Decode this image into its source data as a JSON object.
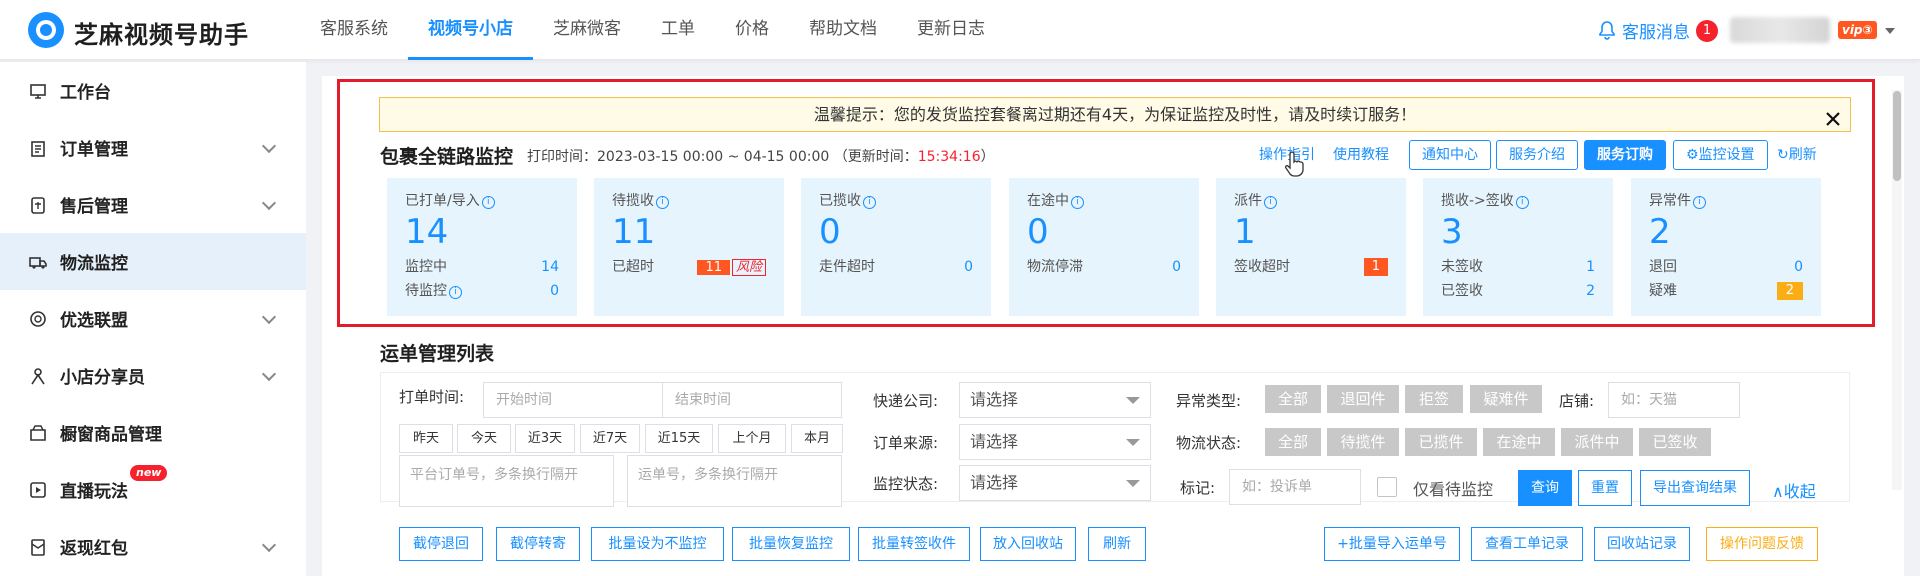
{
  "app": {
    "title": "芝麻视频号助手"
  },
  "nav": [
    "客服系统",
    "视频号小店",
    "芝麻微客",
    "工单",
    "价格",
    "帮助文档",
    "更新日志"
  ],
  "topRight": {
    "msg": "客服消息",
    "msgCount": "1",
    "vip": "vip③"
  },
  "sidebar": [
    {
      "label": "工作台"
    },
    {
      "label": "订单管理"
    },
    {
      "label": "售后管理"
    },
    {
      "label": "物流监控"
    },
    {
      "label": "优选联盟"
    },
    {
      "label": "小店分享员"
    },
    {
      "label": "橱窗商品管理"
    },
    {
      "label": "直播玩法",
      "tag": "new"
    },
    {
      "label": "返现红包"
    }
  ],
  "notice": "温馨提示：您的发货监控套餐离过期还有4天，为保证监控及时性，请及时续订服务！",
  "monitor": {
    "title": "包裹全链路监控",
    "printTimeLabel": "打印时间：2023-03-15 00:00 ~ 04-15 00:00 （更新时间：",
    "updateTime": "15:34:16",
    "closeParen": "）",
    "links": {
      "guide": "操作指引",
      "tutorial": "使用教程"
    },
    "buttons": {
      "notify": "通知中心",
      "intro": "服务介绍",
      "order": "服务订购",
      "settings": "⚙监控设置",
      "refresh": "↻刷新"
    }
  },
  "stats": [
    {
      "label": "已打单/导入",
      "value": "14",
      "r1": "监控中",
      "r1v": "14",
      "r2": "待监控",
      "r2v": "0"
    },
    {
      "label": "待揽收",
      "value": "11",
      "r1": "已超时",
      "r1v": "11",
      "risk": "风险"
    },
    {
      "label": "已揽收",
      "value": "0",
      "r1": "走件超时",
      "r1v": "0"
    },
    {
      "label": "在途中",
      "value": "0",
      "r1": "物流停滞",
      "r1v": "0"
    },
    {
      "label": "派件",
      "value": "1",
      "r1": "签收超时",
      "r1v": "1"
    },
    {
      "label": "揽收->签收",
      "value": "3",
      "r1": "未签收",
      "r1v": "1",
      "r2": "已签收",
      "r2v": "2"
    },
    {
      "label": "异常件",
      "value": "2",
      "r1": "退回",
      "r1v": "0",
      "r2": "疑难",
      "r2v": "2"
    }
  ],
  "list": {
    "title": "运单管理列表",
    "printTime": "打单时间:",
    "startPh": "开始时间",
    "endPh": "结束时间",
    "quick": [
      "昨天",
      "今天",
      "近3天",
      "近7天",
      "近15天",
      "上个月",
      "本月"
    ],
    "orderPh": "平台订单号，多条换行隔开",
    "waybillPh": "运单号，多条换行隔开",
    "express": "快递公司:",
    "source": "订单来源:",
    "monState": "监控状态:",
    "selectPh": "请选择",
    "abnType": "异常类型:",
    "abnTags": [
      "全部",
      "退回件",
      "拒签",
      "疑难件"
    ],
    "shop": "店铺:",
    "shopPh": "如：天猫",
    "logState": "物流状态:",
    "logTags": [
      "全部",
      "待揽件",
      "已揽件",
      "在途中",
      "派件中",
      "已签收"
    ],
    "mark": "标记:",
    "markPh": "如：投诉单",
    "onlyPending": "仅看待监控",
    "query": "查询",
    "reset": "重置",
    "export": "导出查询结果",
    "collapse": "∧收起",
    "actions": [
      "截停退回",
      "截停转寄",
      "批量设为不监控",
      "批量恢复监控",
      "批量转签收件",
      "放入回收站",
      "刷新"
    ],
    "rightActions": [
      "+批量导入运单号",
      "查看工单记录",
      "回收站记录",
      "操作问题反馈"
    ]
  }
}
